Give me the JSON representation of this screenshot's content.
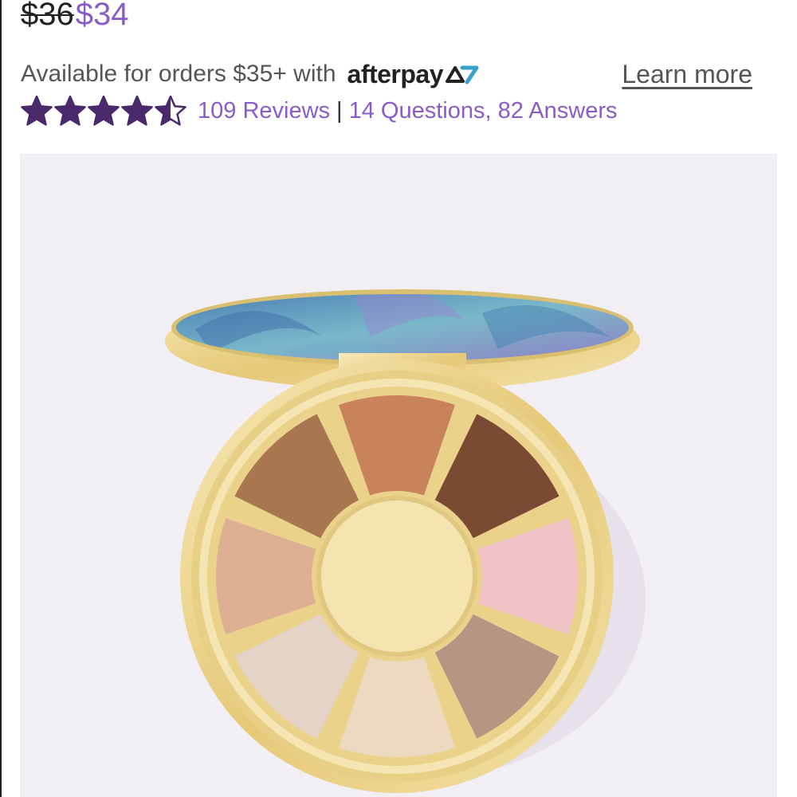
{
  "price": {
    "original": "$36",
    "sale": "$34",
    "original_color": "#222222",
    "sale_color": "#8a5cc8"
  },
  "afterpay": {
    "text": "Available for orders $35+ with",
    "logo_text": "afterpay",
    "logo_mark_icon": "afterpay-arrows-icon",
    "learn_more": "Learn more"
  },
  "rating": {
    "stars": 4.5,
    "out_of": 5,
    "star_color": "#4b2a6b",
    "reviews": "109 Reviews",
    "separator": "|",
    "questions": "14 Questions, 82 Answers",
    "link_color": "#8a5cc8"
  },
  "product_image": {
    "background": "#f2eff4",
    "lid_colors": [
      "#4a7fb5",
      "#7bb8c9",
      "#8e7fc4"
    ],
    "case_color": "#eed9a0",
    "shade_colors": [
      "#a8774f",
      "#c9835a",
      "#7a4a33",
      "#efc2c6",
      "#b69682",
      "#ecd9bf",
      "#e4d3c6",
      "#deb093"
    ]
  }
}
